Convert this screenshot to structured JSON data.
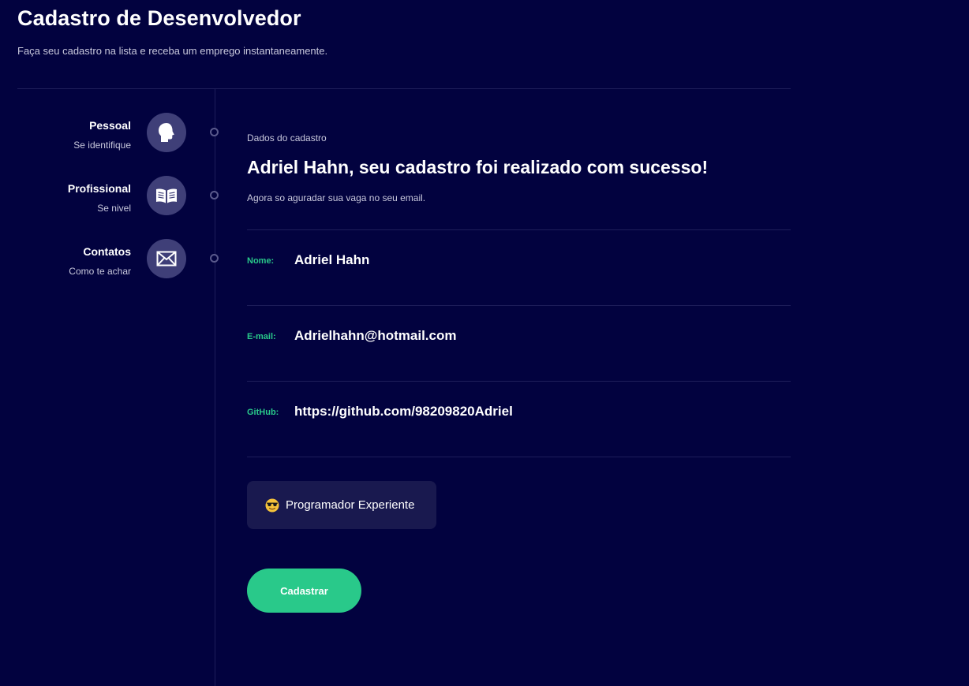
{
  "header": {
    "title": "Cadastro de Desenvolvedor",
    "subtitle": "Faça seu cadastro na lista e receba um emprego instantaneamente."
  },
  "steps": [
    {
      "title": "Pessoal",
      "subtitle": "Se identifique",
      "icon": "person-head-icon"
    },
    {
      "title": "Profissional",
      "subtitle": "Se nivel",
      "icon": "book-icon"
    },
    {
      "title": "Contatos",
      "subtitle": "Como te achar",
      "icon": "envelope-icon"
    }
  ],
  "content": {
    "eyebrow": "Dados do cadastro",
    "headline": "Adriel Hahn, seu cadastro foi realizado com sucesso!",
    "note": "Agora so aguradar sua vaga no seu email."
  },
  "fields": [
    {
      "label": "Nome:",
      "value": "Adriel Hahn"
    },
    {
      "label": "E-mail:",
      "value": "Adrielhahn@hotmail.com"
    },
    {
      "label": "GitHub:",
      "value": "https://github.com/98209820Adriel"
    }
  ],
  "level": {
    "icon": "sunglasses-emoji-icon",
    "label": "Programador Experiente"
  },
  "submit_label": "Cadastrar",
  "colors": {
    "background": "#02023f",
    "accent": "#29c98a",
    "card": "#19194f",
    "step_circle": "#3f3f78"
  }
}
